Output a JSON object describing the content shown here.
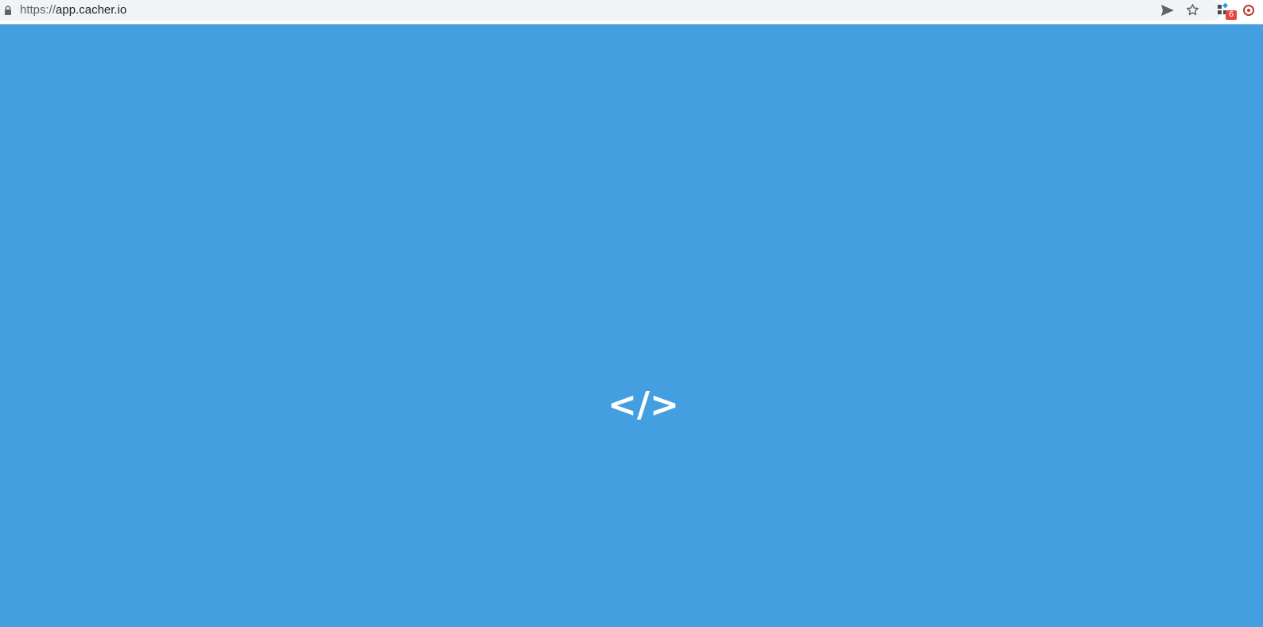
{
  "browser": {
    "url_scheme": "https://",
    "url_host": "app.cacher.io",
    "lock_icon": "lock-icon",
    "send_icon": "send-icon",
    "star_icon": "star-icon",
    "extension_icon": "extension-icon",
    "extension_badge": "6"
  },
  "app": {
    "logo_text": "</>",
    "background_color": "#449fe0",
    "logo_color": "#ffffff"
  }
}
